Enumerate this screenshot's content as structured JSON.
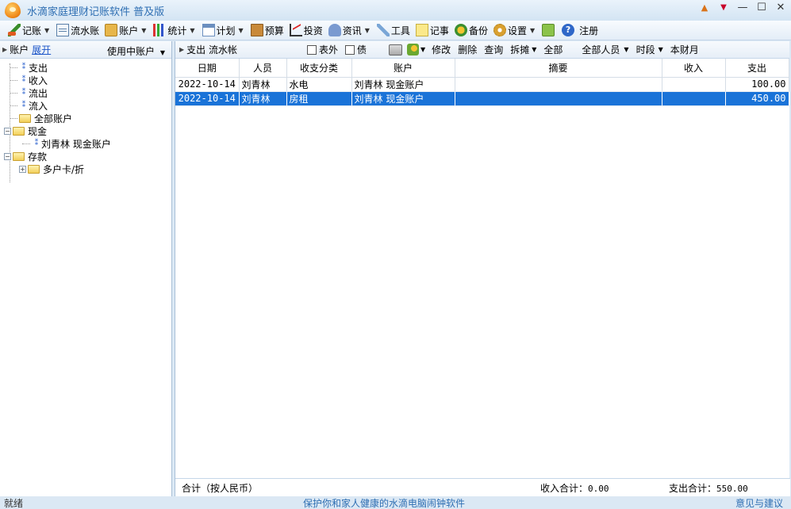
{
  "window": {
    "title": "水滴家庭理财记账软件  普及版"
  },
  "toolbar": {
    "items": [
      {
        "label": "记账",
        "icon": "pen-icon",
        "dropdown": true
      },
      {
        "label": "流水账",
        "icon": "ledger-icon",
        "dropdown": false
      },
      {
        "label": "账户",
        "icon": "wallet-icon",
        "dropdown": true
      },
      {
        "label": "统计",
        "icon": "bar-chart-icon",
        "dropdown": true
      },
      {
        "label": "计划",
        "icon": "calendar-icon",
        "dropdown": true
      },
      {
        "label": "预算",
        "icon": "book-icon",
        "dropdown": false
      },
      {
        "label": "投资",
        "icon": "line-graph-icon",
        "dropdown": false
      },
      {
        "label": "资讯",
        "icon": "news-icon",
        "dropdown": true
      },
      {
        "label": "工具",
        "icon": "tools-icon",
        "dropdown": false
      },
      {
        "label": "记事",
        "icon": "note-icon",
        "dropdown": false
      },
      {
        "label": "备份",
        "icon": "backup-icon",
        "dropdown": false
      },
      {
        "label": "设置",
        "icon": "gear-icon",
        "dropdown": true
      },
      {
        "label": "注册",
        "icon": "help-icon",
        "dropdown": false
      }
    ]
  },
  "left_panel": {
    "header_label": "账户",
    "expand_link": "展开",
    "filter_label": "使用中账户",
    "tree": [
      {
        "label": "支出",
        "kind": "leaf",
        "level": 0
      },
      {
        "label": "收入",
        "kind": "leaf",
        "level": 0
      },
      {
        "label": "流出",
        "kind": "leaf",
        "level": 0
      },
      {
        "label": "流入",
        "kind": "leaf",
        "level": 0
      },
      {
        "label": "全部账户",
        "kind": "folder",
        "level": 0
      },
      {
        "label": "现金",
        "kind": "folder-open",
        "level": 0
      },
      {
        "label": "刘青林 现金账户",
        "kind": "leaf",
        "level": 1
      },
      {
        "label": "存款",
        "kind": "folder-open",
        "level": 0
      },
      {
        "label": "多户卡/折",
        "kind": "folder-collapsed",
        "level": 1
      }
    ]
  },
  "right_toolbar": {
    "view_label": "支出 流水帐",
    "checkbox_outside": "表外",
    "checkbox_debt": "债",
    "edit": "修改",
    "delete": "删除",
    "query": "查询",
    "split": "拆摊",
    "scope": "全部",
    "members": "全部人员",
    "period_label": "时段",
    "period_value": "本财月"
  },
  "table": {
    "columns": [
      "日期",
      "人员",
      "收支分类",
      "账户",
      "摘要",
      "收入",
      "支出"
    ],
    "rows": [
      {
        "date": "2022-10-14",
        "person": "刘青林",
        "category": "水电",
        "account": "刘青林 现金账户",
        "memo": "",
        "income": "",
        "expense": "100.00",
        "selected": false
      },
      {
        "date": "2022-10-14",
        "person": "刘青林",
        "category": "房租",
        "account": "刘青林 现金账户",
        "memo": "",
        "income": "",
        "expense": "450.00",
        "selected": true
      }
    ]
  },
  "totals": {
    "label": "合计（按人民币）",
    "income_label": "收入合计：",
    "income_value": "0.00",
    "expense_label": "支出合计：",
    "expense_value": "550.00"
  },
  "status": {
    "left": "就绪",
    "middle": "保护你和家人健康的水滴电脑闹钟软件",
    "right": "意见与建议"
  },
  "colors": {
    "title": "#2f6fb3",
    "selection": "#1a73d8",
    "link": "#1d56c9"
  }
}
